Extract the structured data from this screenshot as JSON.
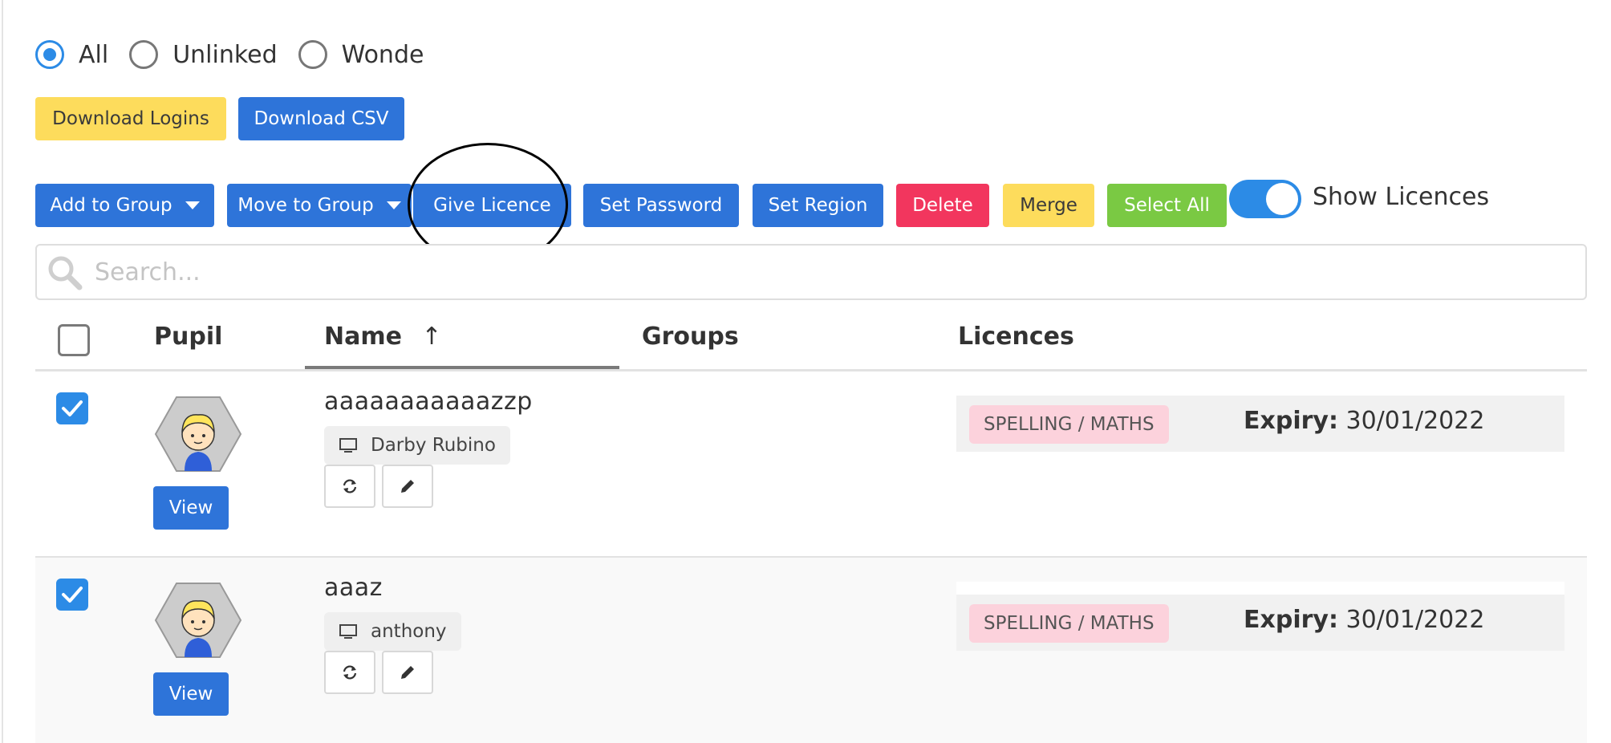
{
  "filters": {
    "all": "All",
    "unlinked": "Unlinked",
    "wonde": "Wonde",
    "selected": "All"
  },
  "buttons": {
    "download_logins": "Download Logins",
    "download_csv": "Download CSV",
    "add_to_group": "Add to Group",
    "move_to_group": "Move to Group",
    "give_licence": "Give Licence",
    "set_password": "Set Password",
    "set_region": "Set Region",
    "delete": "Delete",
    "merge": "Merge",
    "select_all": "Select All"
  },
  "toggle": {
    "label": "Show Licences",
    "on": true
  },
  "search": {
    "placeholder": "Search..."
  },
  "table": {
    "headers": {
      "pupil": "Pupil",
      "name": "Name",
      "sort_arrow": "↑",
      "groups": "Groups",
      "licences": "Licences"
    },
    "view_label": "View",
    "expiry_label": "Expiry:",
    "rows": [
      {
        "name": "aaaaaaaaaaazzp",
        "teacher": "Darby Rubino",
        "checked": true,
        "licence": "SPELLING / MATHS",
        "expiry": "30/01/2022"
      },
      {
        "name": "aaaz",
        "teacher": "anthony",
        "checked": true,
        "licence": "SPELLING / MATHS",
        "expiry": "30/01/2022"
      }
    ]
  },
  "colors": {
    "primary_blue": "#2e74d9",
    "accent_blue": "#2c8be6",
    "yellow": "#fddc5c",
    "red": "#f2365e",
    "green": "#7ac943",
    "licence_pink": "#fcd2dc"
  }
}
